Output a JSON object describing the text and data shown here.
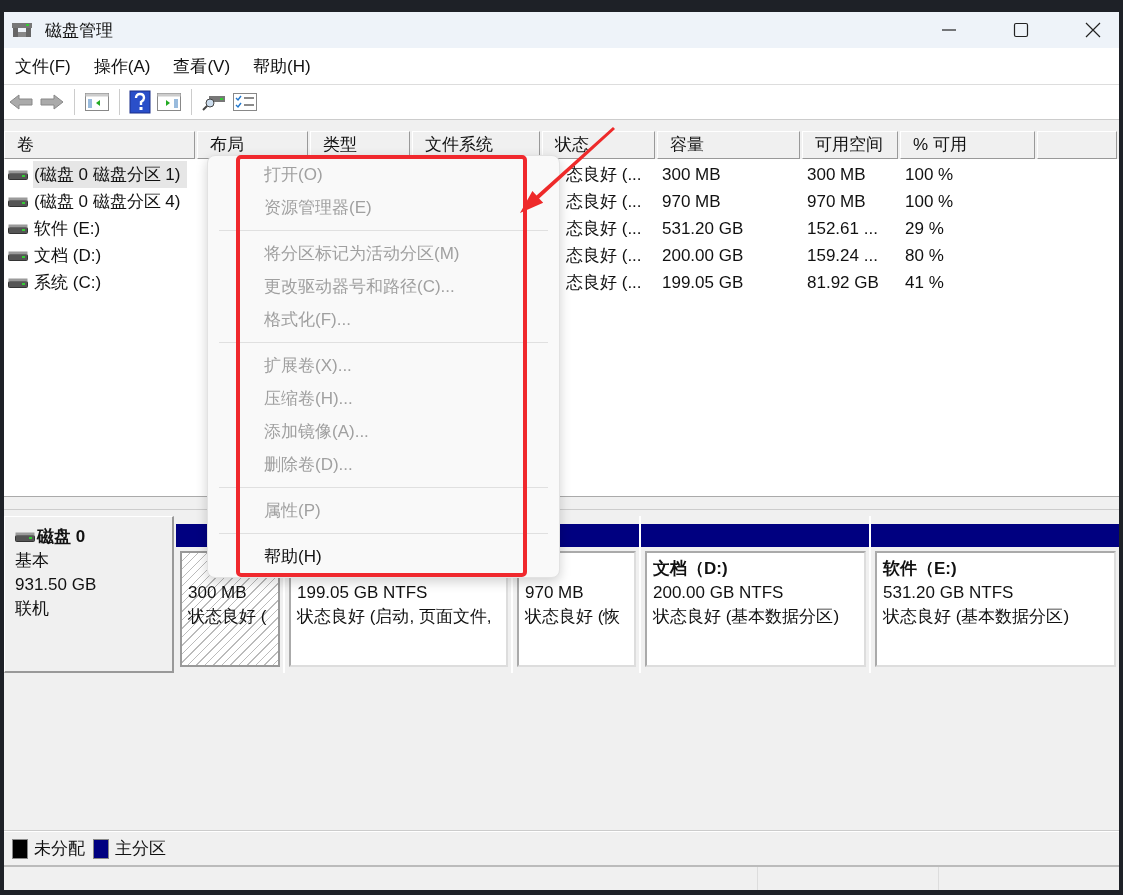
{
  "window": {
    "title": "磁盘管理"
  },
  "menu_bar": [
    {
      "label": "文件(F)"
    },
    {
      "label": "操作(A)"
    },
    {
      "label": "查看(V)"
    },
    {
      "label": "帮助(H)"
    }
  ],
  "table": {
    "columns": [
      "卷",
      "布局",
      "类型",
      "文件系统",
      "状态",
      "容量",
      "可用空间",
      "% 可用"
    ],
    "rows": [
      {
        "volume": "(磁盘 0 磁盘分区 1)",
        "status": "态良好 (...",
        "capacity": "300 MB",
        "free": "300 MB",
        "percent": "100 %",
        "selected": true
      },
      {
        "volume": "(磁盘 0 磁盘分区 4)",
        "status": "态良好 (...",
        "capacity": "970 MB",
        "free": "970 MB",
        "percent": "100 %",
        "selected": false
      },
      {
        "volume": "软件 (E:)",
        "status": "态良好 (...",
        "capacity": "531.20 GB",
        "free": "152.61 ...",
        "percent": "29 %",
        "selected": false
      },
      {
        "volume": "文档 (D:)",
        "status": "态良好 (...",
        "capacity": "200.00 GB",
        "free": "159.24 ...",
        "percent": "80 %",
        "selected": false
      },
      {
        "volume": "系统 (C:)",
        "status": "态良好 (...",
        "capacity": "199.05 GB",
        "free": "81.92 GB",
        "percent": "41 %",
        "selected": false
      }
    ]
  },
  "disk_map": {
    "disk": {
      "name": "磁盘 0",
      "type": "基本",
      "size": "931.50 GB",
      "state": "联机"
    },
    "partitions": [
      {
        "size": "300 MB",
        "status": "状态良好 (",
        "selected": true
      },
      {
        "size": "199.05 GB NTFS",
        "status": "状态良好 (启动, 页面文件,",
        "selected": false
      },
      {
        "size": "970 MB",
        "status": "状态良好 (恢",
        "selected": false
      },
      {
        "title": "文档（D:)",
        "size": "200.00 GB NTFS",
        "status": "状态良好 (基本数据分区)",
        "selected": false
      },
      {
        "title": "软件（E:)",
        "size": "531.20 GB NTFS",
        "status": "状态良好 (基本数据分区)",
        "selected": false
      }
    ]
  },
  "legend": [
    {
      "label": "未分配",
      "color": "#000000"
    },
    {
      "label": "主分区",
      "color": "#000080"
    }
  ],
  "context_menu": {
    "items": [
      {
        "kind": "item",
        "label": "打开(O)",
        "disabled": true
      },
      {
        "kind": "item",
        "label": "资源管理器(E)",
        "disabled": true
      },
      {
        "kind": "separator"
      },
      {
        "kind": "item",
        "label": "将分区标记为活动分区(M)",
        "disabled": true
      },
      {
        "kind": "item",
        "label": "更改驱动器号和路径(C)...",
        "disabled": true
      },
      {
        "kind": "item",
        "label": "格式化(F)...",
        "disabled": true
      },
      {
        "kind": "separator"
      },
      {
        "kind": "item",
        "label": "扩展卷(X)...",
        "disabled": true
      },
      {
        "kind": "item",
        "label": "压缩卷(H)...",
        "disabled": true
      },
      {
        "kind": "item",
        "label": "添加镜像(A)...",
        "disabled": true
      },
      {
        "kind": "item",
        "label": "删除卷(D)...",
        "disabled": true
      },
      {
        "kind": "separator"
      },
      {
        "kind": "item",
        "label": "属性(P)",
        "disabled": true
      },
      {
        "kind": "separator"
      },
      {
        "kind": "item",
        "label": "帮助(H)",
        "disabled": false
      }
    ]
  }
}
